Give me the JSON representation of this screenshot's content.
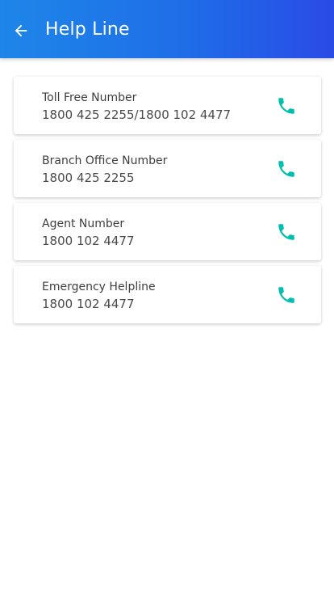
{
  "header": {
    "title": "Help Line",
    "back_icon": "arrow-back-icon"
  },
  "colors": {
    "appbar_start": "#1e86e8",
    "appbar_end": "#2a4be6",
    "phone_icon": "#00bfae"
  },
  "contacts": [
    {
      "label": "Toll Free Number",
      "number": "1800 425 2255/1800 102 4477",
      "icon": "phone-icon"
    },
    {
      "label": "Branch Office Number",
      "number": "1800 425 2255",
      "icon": "phone-icon"
    },
    {
      "label": "Agent Number",
      "number": "1800 102 4477",
      "icon": "phone-icon"
    },
    {
      "label": "Emergency Helpline",
      "number": "1800 102 4477",
      "icon": "phone-icon"
    }
  ]
}
